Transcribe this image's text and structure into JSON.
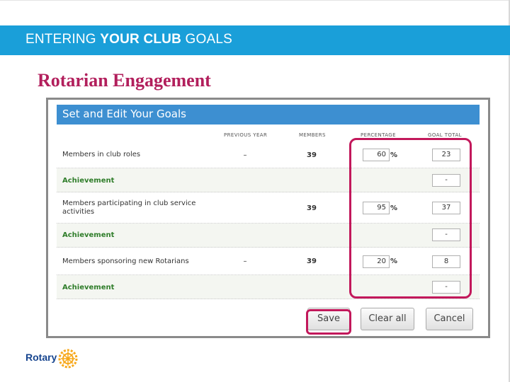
{
  "slide": {
    "title_pre": "ENTERING",
    "title_bold": "YOUR CLUB",
    "title_post": "GOALS",
    "subtitle": "Rotarian Engagement"
  },
  "panel": {
    "title": "Set and Edit Your Goals",
    "columns": [
      "PREVIOUS YEAR",
      "MEMBERS",
      "PERCENTAGE",
      "GOAL TOTAL"
    ],
    "rows": [
      {
        "label": "Members in club roles",
        "previous": "–",
        "members": "39",
        "percentage": "60",
        "pct_sign": "%",
        "goal": "23"
      },
      {
        "label": "Achievement",
        "goal": "-"
      },
      {
        "label": "Members participating in club service activities",
        "previous": "",
        "members": "39",
        "percentage": "95",
        "pct_sign": "%",
        "goal": "37"
      },
      {
        "label": "Achievement",
        "goal": "-"
      },
      {
        "label": "Members sponsoring new Rotarians",
        "previous": "–",
        "members": "39",
        "percentage": "20",
        "pct_sign": "%",
        "goal": "8"
      },
      {
        "label": "Achievement",
        "goal": "-"
      }
    ],
    "buttons": {
      "save": "Save",
      "clear": "Clear all",
      "cancel": "Cancel"
    }
  },
  "logo": {
    "text": "Rotary"
  },
  "colors": {
    "header_band": "#1a9fd9",
    "subtitle": "#b21f5c",
    "panel_header": "#3d8fd1",
    "highlight": "#c2185b",
    "achievement": "#2f7d2a"
  }
}
